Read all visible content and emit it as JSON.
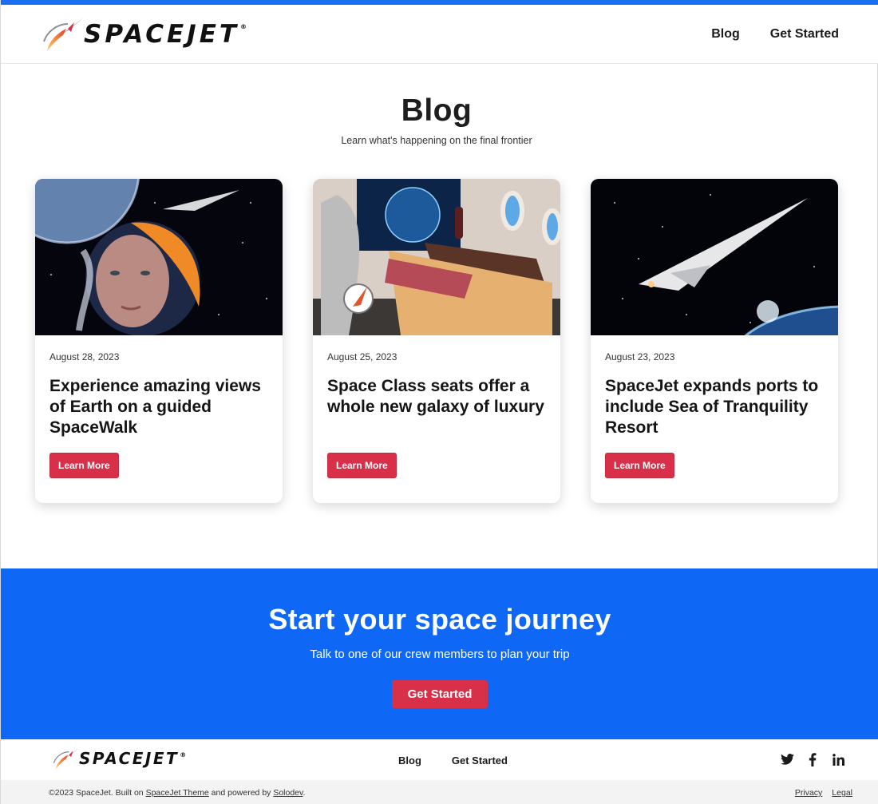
{
  "header": {
    "logo_text": "SPACEJET",
    "logo_reg": "®",
    "nav": [
      {
        "label": "Blog"
      },
      {
        "label": "Get Started"
      }
    ]
  },
  "intro": {
    "title": "Blog",
    "subtitle": "Learn what's happening on the final frontier"
  },
  "posts": [
    {
      "date": "August 28, 2023",
      "title": "Experience amazing views of Earth on a guided SpaceWalk",
      "button": "Learn More"
    },
    {
      "date": "August 25, 2023",
      "title": "Space Class seats offer a whole new galaxy of luxury",
      "button": "Learn More"
    },
    {
      "date": "August 23, 2023",
      "title": "SpaceJet expands ports to include Sea of Tranquility Resort",
      "button": "Learn More"
    }
  ],
  "cta": {
    "title": "Start your space journey",
    "subtitle": "Talk to one of our crew members to plan your trip",
    "button": "Get Started"
  },
  "footer": {
    "logo_text": "SPACEJET",
    "logo_reg": "®",
    "nav": [
      {
        "label": "Blog"
      },
      {
        "label": "Get Started"
      }
    ],
    "social_icons": [
      "twitter-icon",
      "facebook-icon",
      "linkedin-icon"
    ],
    "copyright_prefix": "©2023 SpaceJet. Built on ",
    "theme_link": "SpaceJet Theme",
    "copyright_mid": " and powered by ",
    "solodev_link": "Solodev",
    "copyright_suffix": ".",
    "legal_links": [
      {
        "label": "Privacy"
      },
      {
        "label": "Legal"
      }
    ]
  },
  "colors": {
    "accent_blue": "#0f68f5",
    "button_red": "#d9304a"
  }
}
